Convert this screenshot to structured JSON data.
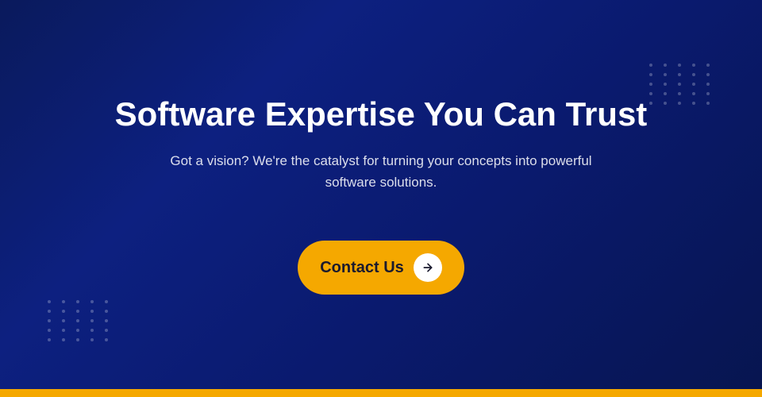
{
  "hero": {
    "title": "Software Expertise You Can Trust",
    "subtitle": "Got a vision? We're the catalyst for turning your concepts into powerful software solutions.",
    "cta_label": "Contact Us",
    "colors": {
      "background_start": "#0a1a5c",
      "background_end": "#071550",
      "accent": "#f5a800",
      "text_primary": "#ffffff",
      "text_secondary": "rgba(255,255,255,0.85)"
    },
    "dots": {
      "count": 25
    }
  }
}
